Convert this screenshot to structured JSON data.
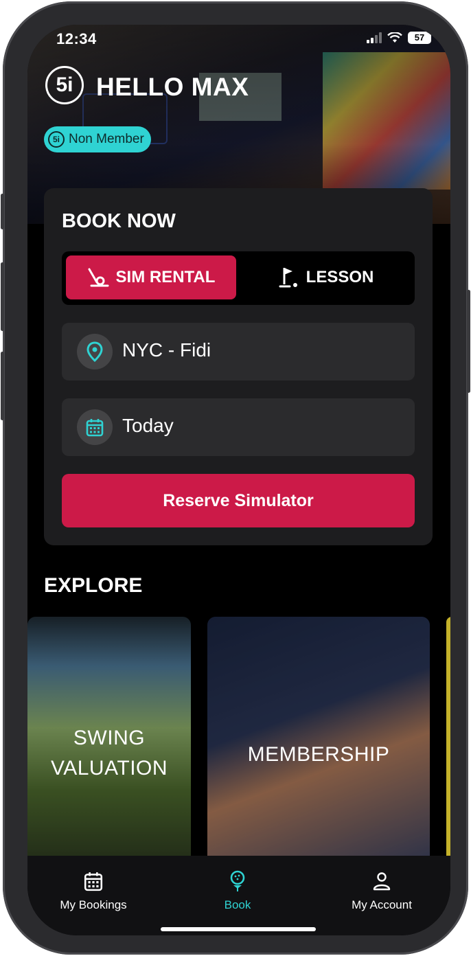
{
  "status": {
    "time": "12:34",
    "battery": "57"
  },
  "header": {
    "logo": "5i",
    "greeting": "HELLO MAX",
    "badge": "Non Member",
    "badge_logo": "5i"
  },
  "booking": {
    "title": "BOOK NOW",
    "tabs": [
      {
        "label": "SIM RENTAL",
        "selected": true
      },
      {
        "label": "LESSON",
        "selected": false
      }
    ],
    "location": "NYC - Fidi",
    "date": "Today",
    "cta": "Reserve Simulator"
  },
  "explore": {
    "title": "EXPLORE",
    "tiles": [
      {
        "line1": "SWING",
        "line2": "VALUATION"
      },
      {
        "label": "MEMBERSHIP"
      }
    ]
  },
  "tabbar": {
    "items": [
      {
        "label": "My Bookings",
        "active": false
      },
      {
        "label": "Book",
        "active": true
      },
      {
        "label": "My Account",
        "active": false
      }
    ]
  },
  "colors": {
    "accent": "#cc1a48",
    "teal": "#2fd3d3",
    "active_tab": "#2fd3d3"
  }
}
